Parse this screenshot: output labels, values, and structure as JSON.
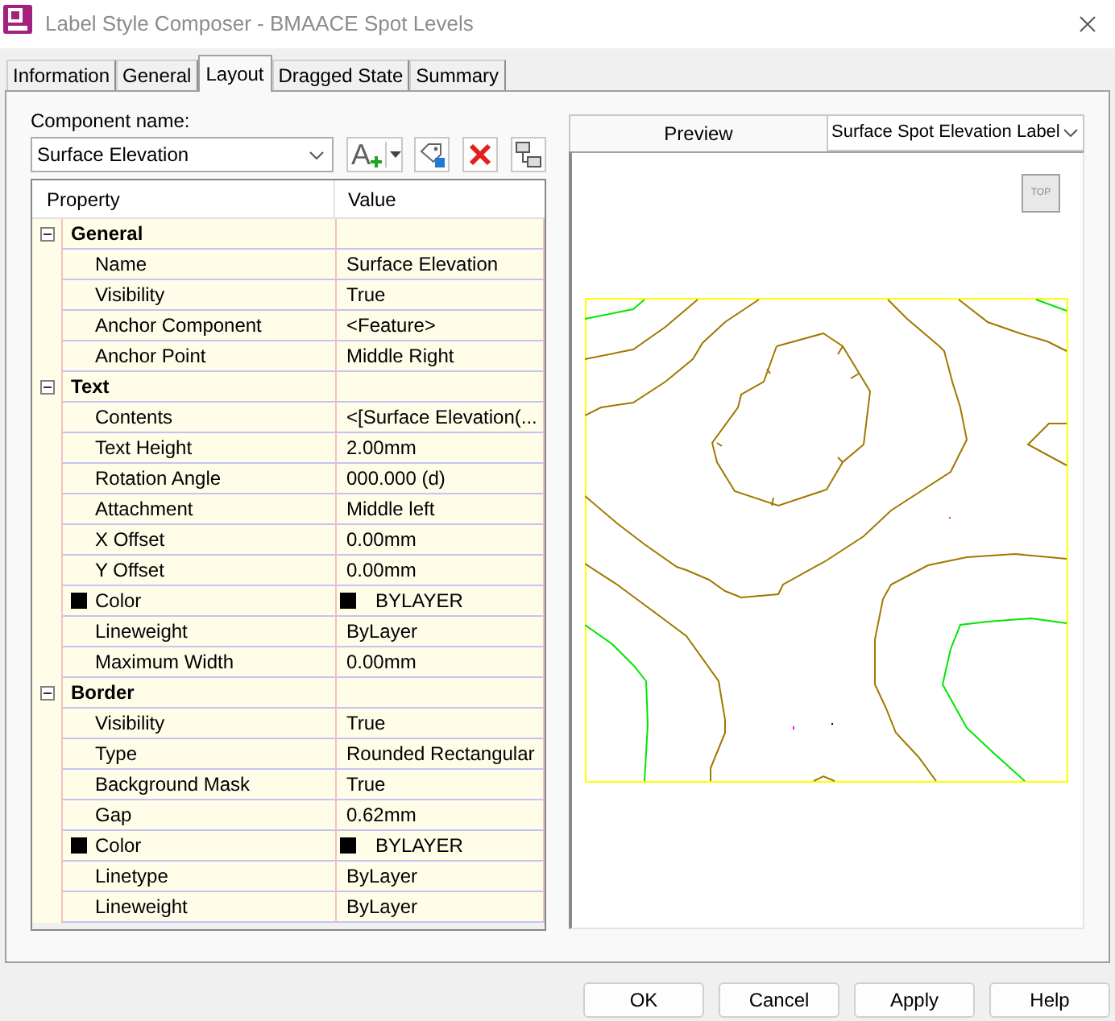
{
  "window": {
    "title": "Label Style Composer - BMAACE Spot Levels"
  },
  "tabs": [
    {
      "label": "Information",
      "selected": false
    },
    {
      "label": "General",
      "selected": false
    },
    {
      "label": "Layout",
      "selected": true
    },
    {
      "label": "Dragged State",
      "selected": false
    },
    {
      "label": "Summary",
      "selected": false
    }
  ],
  "component": {
    "label": "Component name:",
    "value": "Surface Elevation"
  },
  "toolbar": {
    "add_button_glyph": "A"
  },
  "property_grid": {
    "columns": [
      "Property",
      "Value"
    ],
    "categories": [
      {
        "name": "General",
        "expanded": true,
        "properties": [
          {
            "kind": "text",
            "name": "Name",
            "value": "Surface Elevation"
          },
          {
            "kind": "text",
            "name": "Visibility",
            "value": "True"
          },
          {
            "kind": "text",
            "name": "Anchor Component",
            "value": "<Feature>"
          },
          {
            "kind": "text",
            "name": "Anchor Point",
            "value": "Middle Right"
          }
        ]
      },
      {
        "name": "Text",
        "expanded": true,
        "properties": [
          {
            "kind": "text",
            "name": "Contents",
            "value": "<[Surface Elevation(..."
          },
          {
            "kind": "text",
            "name": "Text Height",
            "value": "2.00mm"
          },
          {
            "kind": "text",
            "name": "Rotation Angle",
            "value": "000.000 (d)"
          },
          {
            "kind": "text",
            "name": "Attachment",
            "value": "Middle left"
          },
          {
            "kind": "text",
            "name": "X Offset",
            "value": "0.00mm"
          },
          {
            "kind": "text",
            "name": "Y Offset",
            "value": "0.00mm"
          },
          {
            "kind": "color",
            "name": "Color",
            "value": "BYLAYER",
            "color": "#000000"
          },
          {
            "kind": "text",
            "name": "Lineweight",
            "value": "ByLayer"
          },
          {
            "kind": "text",
            "name": "Maximum Width",
            "value": "0.00mm"
          }
        ]
      },
      {
        "name": "Border",
        "expanded": true,
        "properties": [
          {
            "kind": "text",
            "name": "Visibility",
            "value": "True"
          },
          {
            "kind": "text",
            "name": "Type",
            "value": "Rounded Rectangular"
          },
          {
            "kind": "text",
            "name": "Background Mask",
            "value": "True"
          },
          {
            "kind": "text",
            "name": "Gap",
            "value": "0.62mm"
          },
          {
            "kind": "color",
            "name": "Color",
            "value": "BYLAYER",
            "color": "#000000"
          },
          {
            "kind": "text",
            "name": "Linetype",
            "value": "ByLayer"
          },
          {
            "kind": "text",
            "name": "Lineweight",
            "value": "ByLayer"
          }
        ]
      }
    ]
  },
  "preview": {
    "label": "Preview",
    "view_dropdown": "Surface Spot Elevation Label",
    "view_cube": "TOP"
  },
  "buttons": [
    "OK",
    "Cancel",
    "Apply",
    "Help"
  ]
}
